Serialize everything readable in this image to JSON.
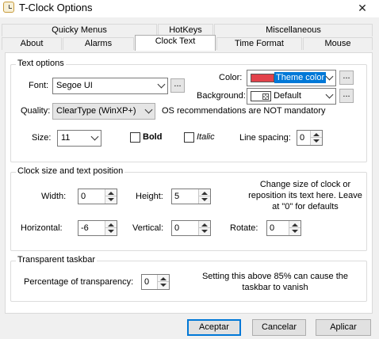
{
  "window": {
    "title": "T-Clock Options",
    "close_glyph": "✕"
  },
  "tabs_row1": [
    {
      "label": "Quicky Menus"
    },
    {
      "label": "HotKeys"
    },
    {
      "label": "Miscellaneous"
    }
  ],
  "tabs_row2": [
    {
      "label": "About"
    },
    {
      "label": "Alarms"
    },
    {
      "label": "Clock Text"
    },
    {
      "label": "Time Format"
    },
    {
      "label": "Mouse"
    }
  ],
  "active_tab": "Clock Text",
  "text_options": {
    "title": "Text options",
    "font_label": "Font:",
    "font_value": "Segoe UI",
    "dots": "...",
    "color_label": "Color:",
    "color_value": "Theme color",
    "color_swatch": "#e2424b",
    "background_label": "Background:",
    "background_value": "Default",
    "quality_label": "Quality:",
    "quality_value": "ClearType (WinXP+)",
    "os_note": "OS recommendations are NOT mandatory",
    "size_label": "Size:",
    "size_value": "11",
    "bold_label": "Bold",
    "bold_checked": false,
    "italic_label": "Italic",
    "italic_checked": false,
    "line_spacing_label": "Line spacing:",
    "line_spacing_value": "0"
  },
  "clock_size": {
    "title": "Clock size and text position",
    "width_label": "Width:",
    "width_value": "0",
    "height_label": "Height:",
    "height_value": "5",
    "hint": "Change size of clock or reposition its text here. Leave at \"0\" for defaults",
    "horizontal_label": "Horizontal:",
    "horizontal_value": "-6",
    "vertical_label": "Vertical:",
    "vertical_value": "0",
    "rotate_label": "Rotate:",
    "rotate_value": "0"
  },
  "transparency": {
    "title": "Transparent taskbar",
    "percent_label": "Percentage of transparency:",
    "percent_value": "0",
    "hint": "Setting this above 85% can cause the taskbar to vanish"
  },
  "buttons": {
    "ok": "Aceptar",
    "cancel": "Cancelar",
    "apply": "Aplicar"
  },
  "colors": {
    "accent": "#0078d7",
    "window_bg": "#f0f0f0"
  }
}
